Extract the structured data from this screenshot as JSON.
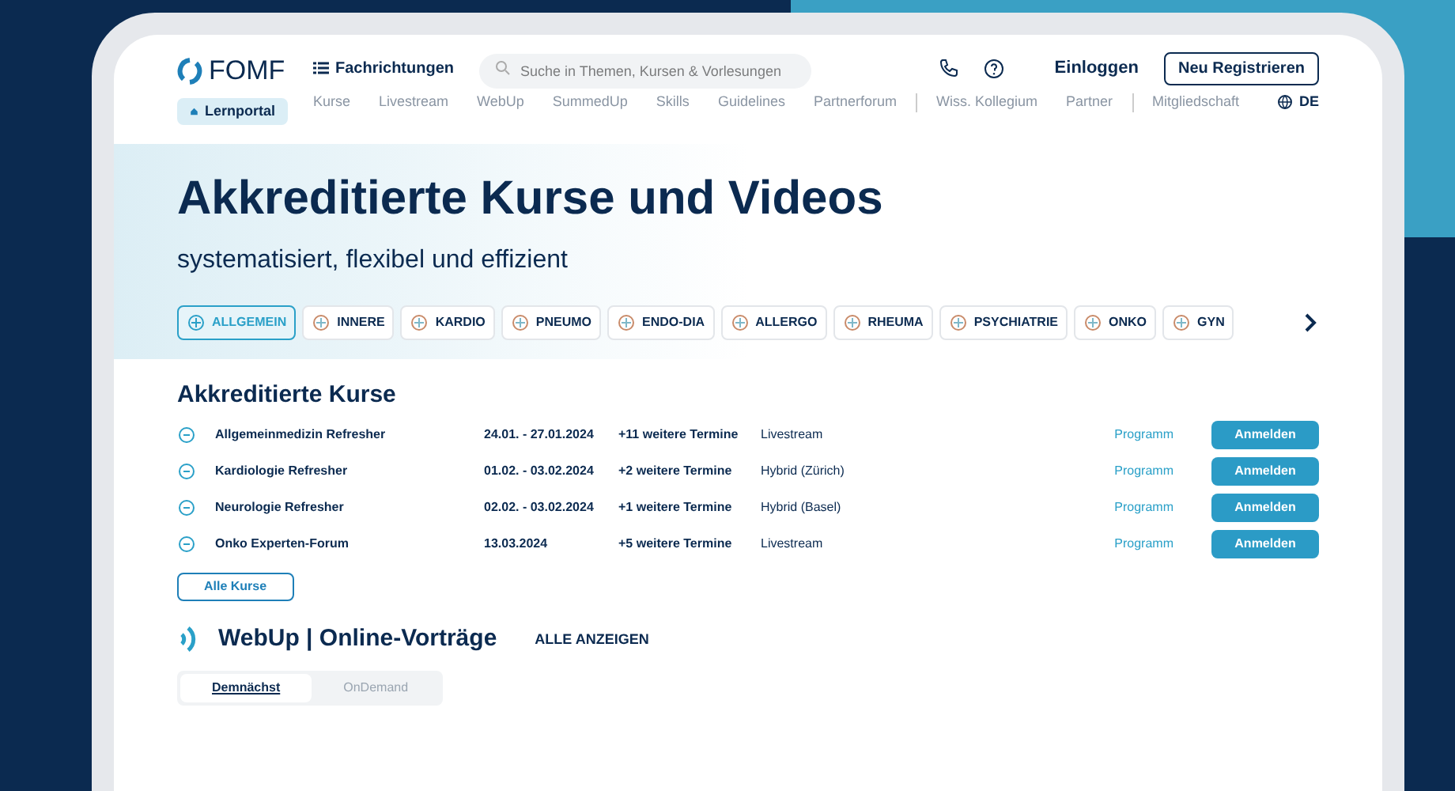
{
  "header": {
    "logo": "FOMF",
    "portal": "Lernportal",
    "categories": "Fachrichtungen",
    "search": {
      "placeholder": "Suche in Themen, Kursen & Vorlesungen"
    },
    "nav_groups": [
      [
        "Kurse",
        "Livestream",
        "WebUp",
        "SummedUp",
        "Skills",
        "Guidelines",
        "Partnerforum"
      ],
      [
        "Wiss. Kollegium",
        "Partner"
      ],
      [
        "Mitgliedschaft"
      ]
    ],
    "login": "Einloggen",
    "register": "Neu Registrieren",
    "language": "DE"
  },
  "hero": {
    "title": "Akkreditierte Kurse und Videos",
    "subtitle": "systematisiert, flexibel und effizient",
    "specialties": [
      {
        "label": "ALLGEMEIN",
        "selected": true
      },
      {
        "label": "INNERE",
        "selected": false
      },
      {
        "label": "KARDIO",
        "selected": false
      },
      {
        "label": "PNEUMO",
        "selected": false
      },
      {
        "label": "ENDO-DIA",
        "selected": false
      },
      {
        "label": "ALLERGO",
        "selected": false
      },
      {
        "label": "RHEUMA",
        "selected": false
      },
      {
        "label": "PSYCHIATRIE",
        "selected": false
      },
      {
        "label": "ONKO",
        "selected": false
      },
      {
        "label": "GYN",
        "selected": false
      }
    ]
  },
  "courses": {
    "title": "Akkreditierte Kurse",
    "rows": [
      {
        "name": "Allgemeinmedizin Refresher",
        "dates": "24.01. - 27.01.2024",
        "more": "+11 weitere Termine",
        "format": "Livestream",
        "program": "Programm",
        "action": "Anmelden"
      },
      {
        "name": "Kardiologie Refresher",
        "dates": "01.02. - 03.02.2024",
        "more": "+2 weitere Termine",
        "format": "Hybrid (Zürich)",
        "program": "Programm",
        "action": "Anmelden"
      },
      {
        "name": "Neurologie Refresher",
        "dates": "02.02. - 03.02.2024",
        "more": "+1 weitere Termine",
        "format": "Hybrid (Basel)",
        "program": "Programm",
        "action": "Anmelden"
      },
      {
        "name": "Onko Experten-Forum",
        "dates": "13.03.2024",
        "more": "+5 weitere Termine",
        "format": "Livestream",
        "program": "Programm",
        "action": "Anmelden"
      }
    ],
    "all_button": "Alle Kurse"
  },
  "webup": {
    "title": "WebUp | Online-Vorträge",
    "link": "ALLE ANZEIGEN",
    "tabs": [
      {
        "label": "Demnächst",
        "selected": true
      },
      {
        "label": "OnDemand",
        "selected": false
      }
    ]
  }
}
